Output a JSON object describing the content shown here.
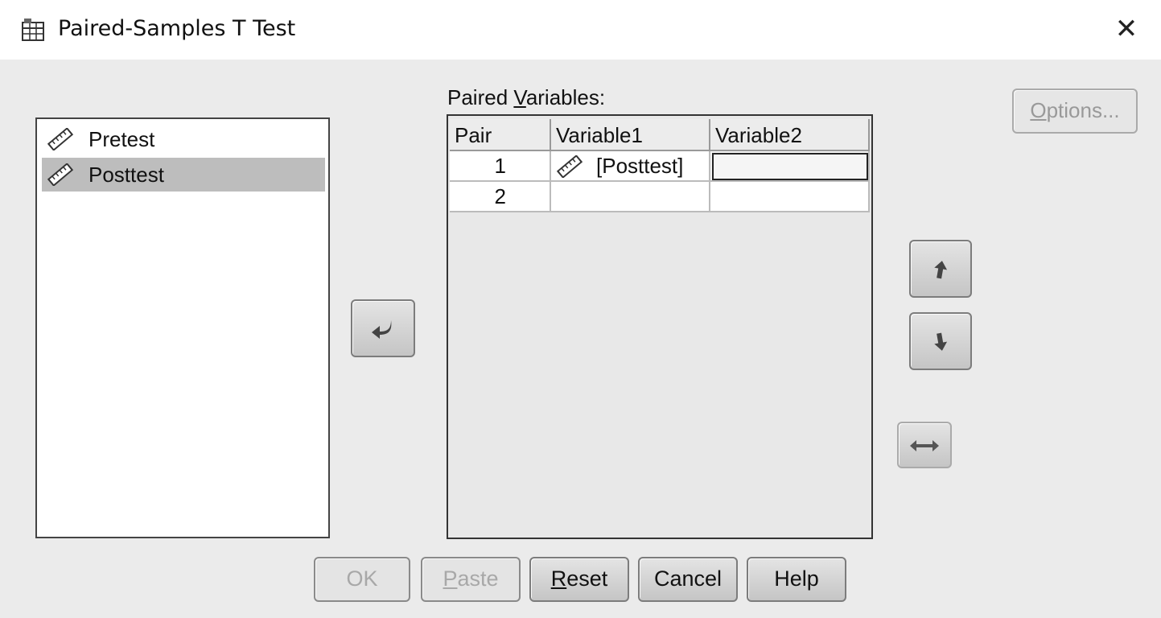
{
  "window": {
    "title": "Paired-Samples T Test",
    "close_glyph": "✕",
    "app_icon": "spss-dialog-icon"
  },
  "source_list": {
    "items": [
      {
        "label": "Pretest",
        "icon": "scale-ruler-icon",
        "selected": false
      },
      {
        "label": "Posttest",
        "icon": "scale-ruler-icon",
        "selected": true
      }
    ]
  },
  "transfer_button": {
    "icon": "transfer-arrow-icon"
  },
  "paired_variables": {
    "label_prefix": "Paired ",
    "label_mnemonic": "V",
    "label_suffix": "ariables:",
    "columns": [
      "Pair",
      "Variable1",
      "Variable2"
    ],
    "rows": [
      {
        "pair": "1",
        "variable1": "[Posttest]",
        "variable1_icon": "scale-ruler-icon",
        "variable2": ""
      },
      {
        "pair": "2",
        "variable1": "",
        "variable2": ""
      }
    ]
  },
  "options_button": {
    "label": "Options...",
    "mnemonic": "O",
    "rest": "ptions...",
    "enabled": false
  },
  "move_up_button": {
    "icon": "arrow-up-icon"
  },
  "move_down_button": {
    "icon": "arrow-down-icon"
  },
  "swap_button": {
    "icon": "swap-horizontal-icon"
  },
  "buttons": {
    "ok": {
      "label": "OK",
      "enabled": false
    },
    "paste": {
      "mnemonic": "P",
      "rest": "aste",
      "enabled": false
    },
    "reset": {
      "mnemonic": "R",
      "rest": "eset",
      "enabled": true
    },
    "cancel": {
      "label": "Cancel",
      "enabled": true
    },
    "help": {
      "label": "Help",
      "enabled": true
    }
  }
}
